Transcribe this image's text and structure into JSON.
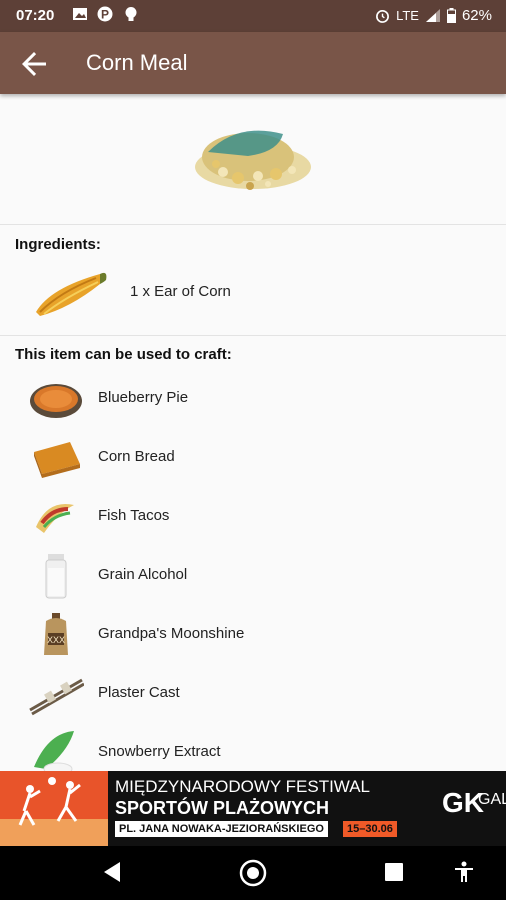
{
  "status_bar": {
    "time": "07:20",
    "network": "LTE",
    "battery": "62%"
  },
  "app_bar": {
    "title": "Corn Meal"
  },
  "ingredients": {
    "heading": "Ingredients:",
    "items": [
      {
        "text": "1 x Ear of Corn",
        "icon": "ear-of-corn-icon"
      }
    ]
  },
  "craft": {
    "heading": "This item can be used to craft:",
    "items": [
      {
        "label": "Blueberry Pie",
        "icon": "blueberry-pie-icon"
      },
      {
        "label": "Corn Bread",
        "icon": "corn-bread-icon"
      },
      {
        "label": "Fish Tacos",
        "icon": "fish-tacos-icon"
      },
      {
        "label": "Grain Alcohol",
        "icon": "grain-alcohol-icon"
      },
      {
        "label": "Grandpa's Moonshine",
        "icon": "moonshine-jug-icon"
      },
      {
        "label": "Plaster Cast",
        "icon": "plaster-cast-icon"
      },
      {
        "label": "Snowberry Extract",
        "icon": "snowberry-extract-icon"
      }
    ]
  },
  "ad": {
    "line1": "MIĘDZYNARODOWY FESTIWAL",
    "line2": "SPORTÓW PLAŻOWYCH",
    "address": "PL. JANA NOWAKA-JEZIORAŃSKIEGO",
    "dates": "15–30.06",
    "brand": "GK",
    "brand2": "GAL",
    "accent": "#f05a28"
  },
  "colors": {
    "app_bar": "#795548",
    "status_bar": "#5d4037"
  }
}
